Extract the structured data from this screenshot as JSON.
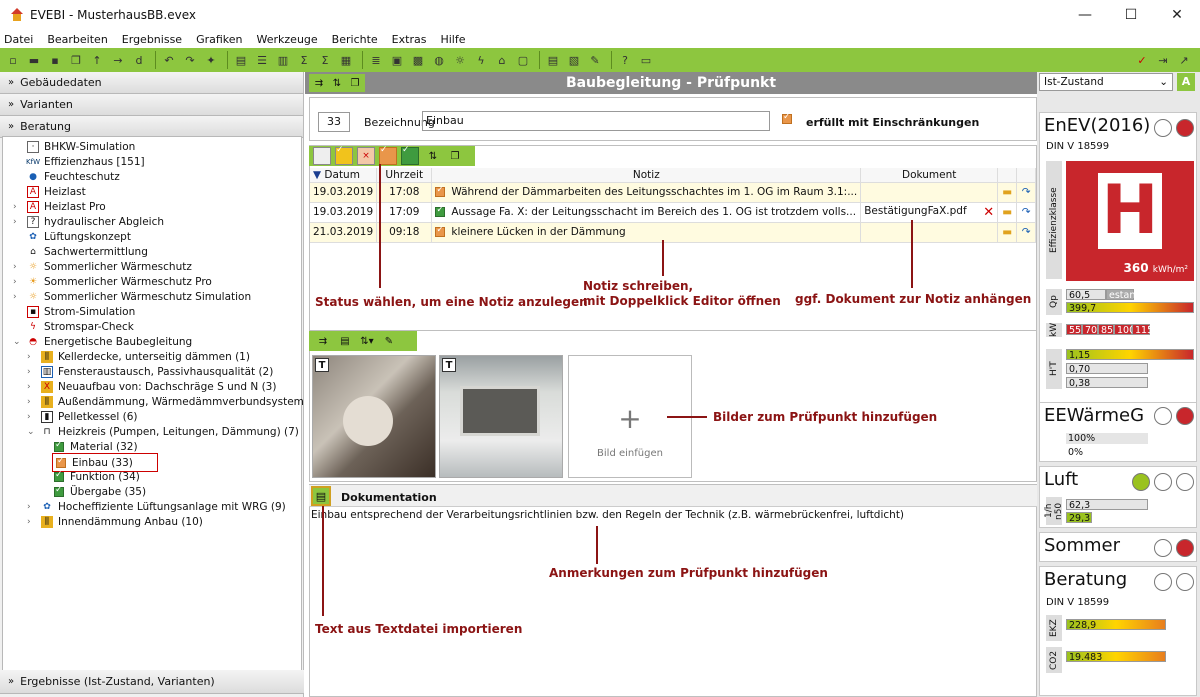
{
  "window": {
    "title": "EVEBI - MusterhausBB.evex",
    "min": "—",
    "max": "☐",
    "close": "✕"
  },
  "menu": [
    "Datei",
    "Bearbeiten",
    "Ergebnisse",
    "Grafiken",
    "Werkzeuge",
    "Berichte",
    "Extras",
    "Hilfe"
  ],
  "left": {
    "sections": [
      "Gebäudedaten",
      "Varianten",
      "Beratung"
    ],
    "bottom": "Ergebnisse (Ist-Zustand, Varianten)",
    "tree": [
      "BHKW-Simulation",
      "Effizienzhaus [151]",
      "Feuchteschutz",
      "Heizlast",
      "Heizlast Pro",
      "hydraulischer Abgleich",
      "Lüftungskonzept",
      "Sachwertermittlung",
      "Sommerlicher Wärmeschutz",
      "Sommerlicher Wärmeschutz Pro",
      "Sommerlicher Wärmeschutz Simulation",
      "Strom-Simulation",
      "Stromspar-Check",
      "Energetische Baubegleitung",
      "Kellerdecke, unterseitig dämmen (1)",
      "Fensteraustausch, Passivhausqualität (2)",
      "Neuaufbau von: Dachschräge S und N (3)",
      "Außendämmung, Wärmedämmverbundsystem (5)",
      "Pelletkessel (6)",
      "Heizkreis (Pumpen, Leitungen, Dämmung) (7)",
      "Material (32)",
      "Einbau (33)",
      "Funktion (34)",
      "Übergabe (35)",
      "Hocheffiziente Lüftungsanlage mit WRG (9)",
      "Innendämmung Anbau (10)"
    ]
  },
  "main": {
    "title": "Baubegleitung - Prüfpunkt",
    "number": "33",
    "bezeichnung_label": "Bezeichnung",
    "bezeichnung_value": "Einbau",
    "status_label": "erfüllt mit Einschränkungen",
    "columns": [
      "Datum",
      "Uhrzeit",
      "Notiz",
      "Dokument"
    ],
    "rows": [
      {
        "date": "19.03.2019",
        "time": "17:08",
        "note": "Während der Dämmarbeiten des Leitungsschachtes im 1. OG im Raum 3.1:...",
        "doc": ""
      },
      {
        "date": "19.03.2019",
        "time": "17:09",
        "note": "Aussage Fa. X: der Leitungsschacht im Bereich des 1. OG ist trotzdem volls...",
        "doc": "BestätigungFaX.pdf"
      },
      {
        "date": "21.03.2019",
        "time": "09:18",
        "note": "kleinere Lücken in der Dämmung",
        "doc": ""
      }
    ],
    "ann_status": "Status wählen, um eine Notiz anzulegen",
    "ann_notiz1": "Notiz schreiben,",
    "ann_notiz2": "mit Doppelklick Editor öffnen",
    "ann_doc": "ggf. Dokument zur Notiz anhängen",
    "ann_bilder": "Bilder zum Prüfpunkt hinzufügen",
    "bild_einfuegen": "Bild einfügen",
    "doku_label": "Dokumentation",
    "doku_text": "Einbau entsprechend der Verarbeitungsrichtlinien bzw. den Regeln der Technik (z.B. wärmebrückenfrei, luftdicht)",
    "ann_anmerk": "Anmerkungen zum Prüfpunkt hinzufügen",
    "ann_text": "Text aus Textdatei importieren"
  },
  "right": {
    "dropdown": "Ist-Zustand",
    "enev": "EnEV(2016)",
    "din1": "DIN V 18599",
    "effizienz": "Effizienzklasse",
    "class": "H",
    "kwh": "360",
    "kwh_unit": "kWh/m²",
    "qp_label": "Qp",
    "qp1": "60,5",
    "qp1b": "estan",
    "qp2": "399,7",
    "kw_label": "kW",
    "kw_vals": [
      "55",
      "70",
      "85",
      "100",
      "115"
    ],
    "ht_label": "H'T",
    "ht1": "1,15",
    "ht2": "0,70",
    "ht3": "0,38",
    "eew": "EEWärmeG",
    "eew1": "100%",
    "eew2": "0%",
    "luft": "Luft",
    "luft_label": "1/h n50",
    "luft1": "62,3",
    "luft2": "29,3",
    "sommer": "Sommer",
    "beratung": "Beratung",
    "din2": "DIN V 18599",
    "ekz_label": "EKZ",
    "ekz": "228,9",
    "co2_label": "CO2",
    "co2": "19.483"
  },
  "colors": {
    "green": "#8dc63f",
    "red": "#c8262c",
    "annotation": "#8b1414"
  }
}
